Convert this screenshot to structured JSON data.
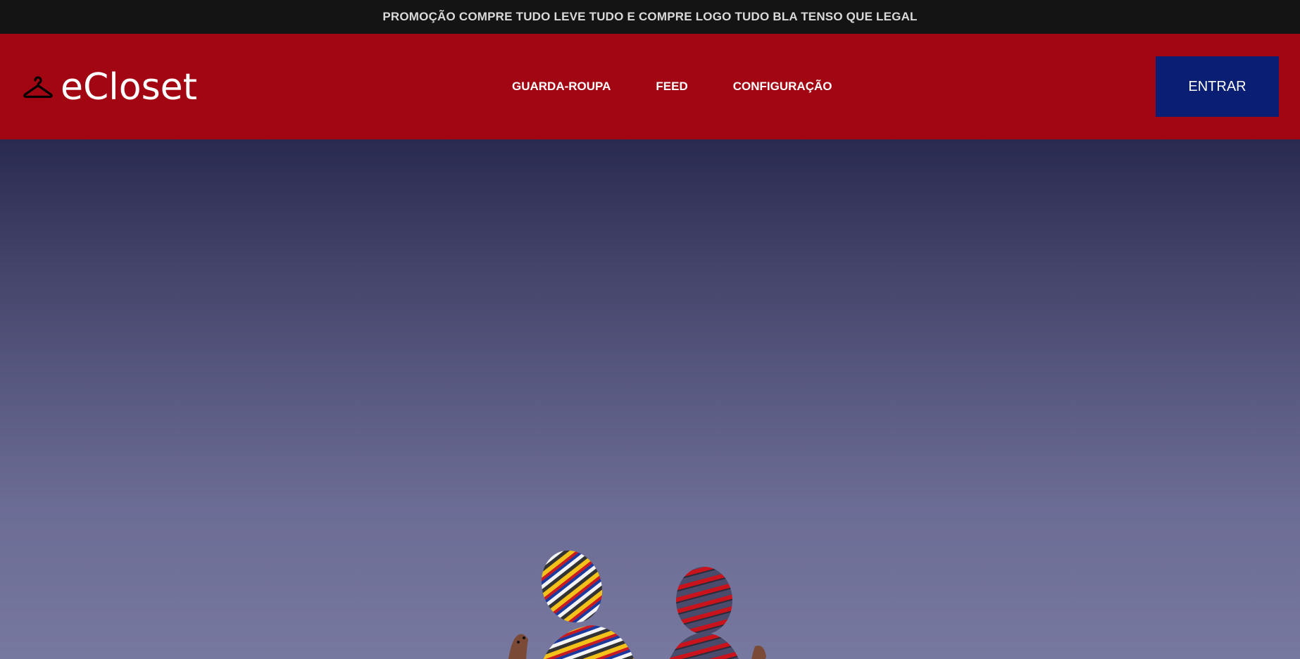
{
  "promo": {
    "text": "PROMOÇÃO COMPRE TUDO LEVE TUDO E COMPRE LOGO TUDO BLA TENSO QUE LEGAL"
  },
  "header": {
    "logo_icon": "hanger-icon",
    "logo_text": "eCloset",
    "nav": [
      {
        "label": "GUARDA-ROUPA"
      },
      {
        "label": "FEED"
      },
      {
        "label": "CONFIGURAÇÃO"
      }
    ],
    "login_label": "ENTRAR"
  },
  "colors": {
    "promo_bg": "#141414",
    "header_bg": "#a30613",
    "button_bg": "#0a1f74",
    "hero_top": "#292a50",
    "hero_bottom": "#77789f"
  }
}
